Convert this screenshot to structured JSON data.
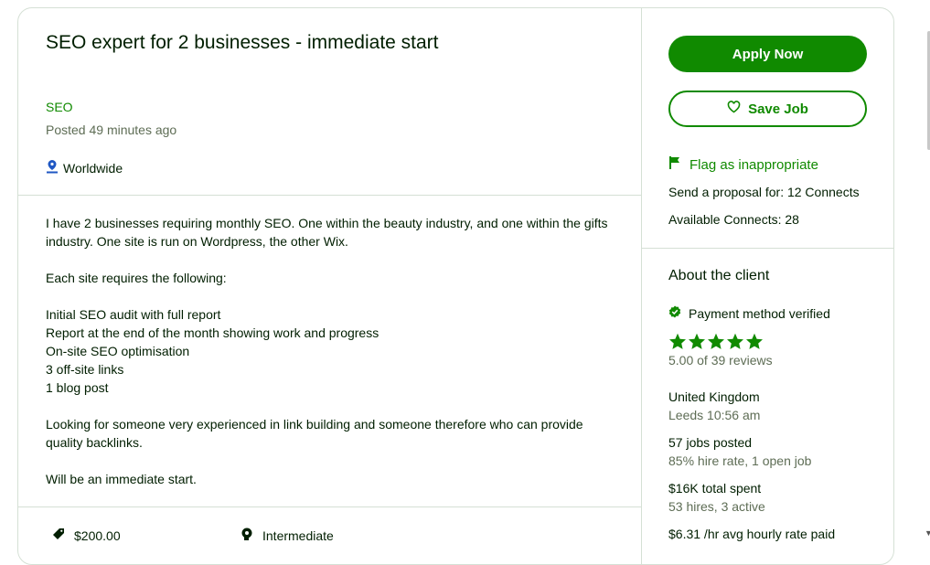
{
  "job": {
    "title": "SEO expert for 2 businesses - immediate start",
    "category": "SEO",
    "posted": "Posted 49 minutes ago",
    "location": "Worldwide",
    "description": [
      "I have 2 businesses requiring monthly SEO. One within the beauty industry, and one within the gifts industry. One site is run on Wordpress, the other Wix.",
      "",
      "Each site requires the following:",
      "",
      "Initial SEO audit with full report",
      "Report at the end of the month showing work and progress",
      "On-site SEO optimisation",
      "3 off-site links",
      "1 blog post",
      "",
      "Looking for someone very experienced in link building and someone therefore who can provide quality backlinks.",
      "",
      "Will be an immediate start."
    ],
    "budget": "$200.00",
    "experience_level": "Intermediate"
  },
  "actions": {
    "apply_label": "Apply Now",
    "save_label": "Save Job",
    "flag_label": "Flag as inappropriate",
    "proposal_cost": "Send a proposal for: 12 Connects",
    "available_connects": "Available Connects: 28"
  },
  "client": {
    "heading": "About the client",
    "payment": "Payment method verified",
    "rating": 5,
    "reviews": "5.00 of 39 reviews",
    "country": "United Kingdom",
    "city_time": "Leeds 10:56 am",
    "jobs_posted": "57 jobs posted",
    "hire_rate": "85% hire rate, 1 open job",
    "total_spent": "$16K total spent",
    "hires": "53 hires, 3 active",
    "avg_rate": "$6.31 /hr avg hourly rate paid"
  },
  "colors": {
    "accent": "#108a00",
    "text": "#001e00",
    "muted": "#5e6d55",
    "border": "#d5e0d5"
  }
}
